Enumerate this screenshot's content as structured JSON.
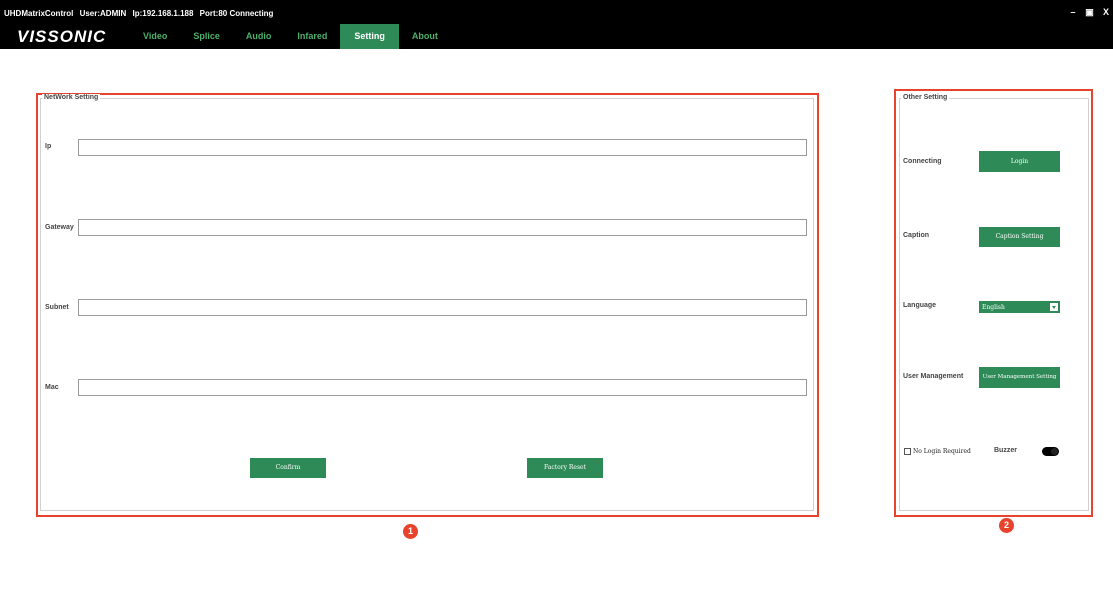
{
  "titlebar": {
    "app": "UHDMatrixControl",
    "user": "User:ADMIN",
    "ip": "Ip:192.168.1.188",
    "port": "Port:80 Connecting",
    "minimize": "–",
    "restore": "▣",
    "close": "X"
  },
  "logo": "VISSONIC",
  "nav": {
    "tabs": [
      {
        "label": "Video"
      },
      {
        "label": "Splice"
      },
      {
        "label": "Audio"
      },
      {
        "label": "Infared"
      },
      {
        "label": "Setting"
      },
      {
        "label": "About"
      }
    ],
    "active_index": 4
  },
  "network": {
    "title": "NetWork Setting",
    "fields": [
      {
        "label": "Ip",
        "value": ""
      },
      {
        "label": "Gateway",
        "value": ""
      },
      {
        "label": "Subnet",
        "value": ""
      },
      {
        "label": "Mac",
        "value": ""
      }
    ],
    "confirm_label": "Confirm",
    "factory_reset_label": "Factory Reset"
  },
  "other": {
    "title": "Other Setting",
    "connecting_label": "Connecting",
    "login_button": "Login",
    "caption_label": "Caption",
    "caption_button": "Caption Setting",
    "language_label": "Language",
    "language_value": "English",
    "user_mgmt_label": "User Management",
    "user_mgmt_button": "User Management Setting",
    "no_login_label": "No Login Required",
    "no_login_checked": false,
    "buzzer_label": "Buzzer",
    "buzzer_on": true
  },
  "markers": [
    "1",
    "2"
  ],
  "colors": {
    "accent": "#2e8b57",
    "highlight": "#e8432c",
    "titlebar": "#000000"
  }
}
